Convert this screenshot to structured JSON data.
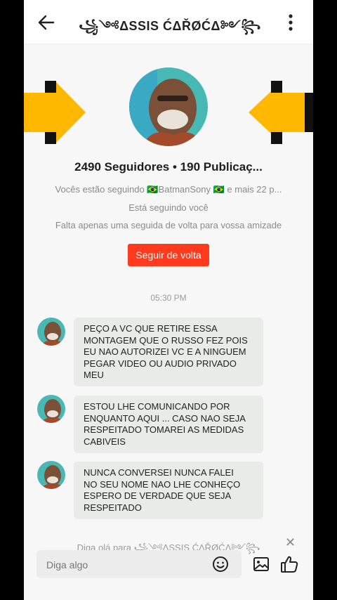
{
  "header": {
    "title": "꧁༺ΔSSIS ĆΔŘØĆΔ༻꧂",
    "back_icon": "back-arrow-icon",
    "more_icon": "more-vertical-icon"
  },
  "profile": {
    "stats": "2490 Seguidores • 190 Publicaç...",
    "mutual": "Vocês estão seguindo 🇧🇷BatmanSony 🇧🇷 e mais 22 p...",
    "follows_you": "Está seguindo você",
    "friendship_hint": "Falta apenas uma seguida de volta para vossa amizade",
    "follow_back_label": "Seguir de volta"
  },
  "chat": {
    "timestamp": "05:30 PM",
    "messages": [
      {
        "lines": [
          "PEÇO A VC  QUE RETIRE ESSA",
          "MONTAGEM QUE O RUSSO FEZ  POIS",
          "EU NAO AUTORIZEI  VC E A NINGUEM",
          "PEGAR VIDEO OU AUDIO PRIVADO",
          "MEU"
        ]
      },
      {
        "lines": [
          "ESTOU LHE COMUNICANDO POR",
          "ENQUANTO AQUI ... CASO NAO SEJA",
          "RESPEITADO TOMAREI AS MEDIDAS",
          "CABIVEIS"
        ]
      },
      {
        "lines": [
          "NUNCA CONVERSEI NUNCA FALEI",
          "NO SEU NOME  NAO LHE CONHEÇO",
          "ESPERO DE VERDADE QUE SEJA",
          "RESPEITADO"
        ]
      }
    ]
  },
  "composer": {
    "hint": "Diga olá para ꧁༺ΔSSIS ĆΔŘØĆΔ༻꧂",
    "placeholder": "Diga algo"
  },
  "colors": {
    "accent": "#ff3a1d",
    "arrow": "#ffb800"
  }
}
